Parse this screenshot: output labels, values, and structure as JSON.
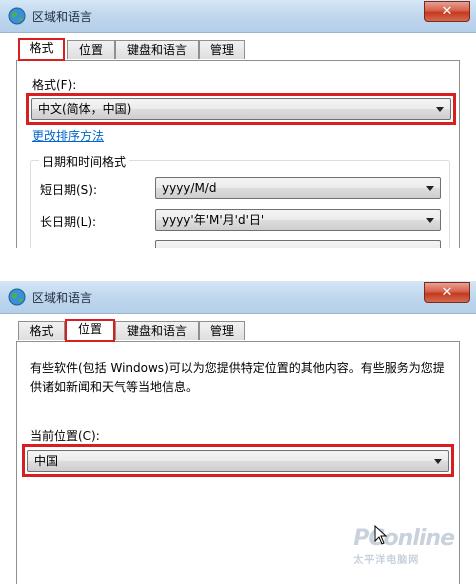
{
  "window": {
    "title": "区域和语言",
    "close_symbol": "✕"
  },
  "tabs": [
    "格式",
    "位置",
    "键盘和语言",
    "管理"
  ],
  "format_tab": {
    "format_label": "格式(F):",
    "format_value": "中文(简体，中国)",
    "sort_link": "更改排序方法",
    "group_title": "日期和时间格式",
    "short_date_label": "短日期(S):",
    "short_date_value": "yyyy/M/d",
    "long_date_label": "长日期(L):",
    "long_date_value": "yyyy'年'M'月'd'日'"
  },
  "location_tab": {
    "description": "有些软件(包括 Windows)可以为您提供特定位置的其他内容。有些服务为您提供诸如新闻和天气等当地信息。",
    "current_location_label": "当前位置(C):",
    "current_location_value": "中国"
  },
  "watermark": {
    "brand": "PConline",
    "sub": "太平洋电脑网"
  },
  "colors": {
    "highlight": "#d81e1e",
    "link": "#0066cc",
    "titlebar": "#c1d8ee"
  },
  "icons": [
    "globe-icon",
    "close-icon",
    "dropdown-arrow-icon",
    "mouse-cursor-icon"
  ]
}
